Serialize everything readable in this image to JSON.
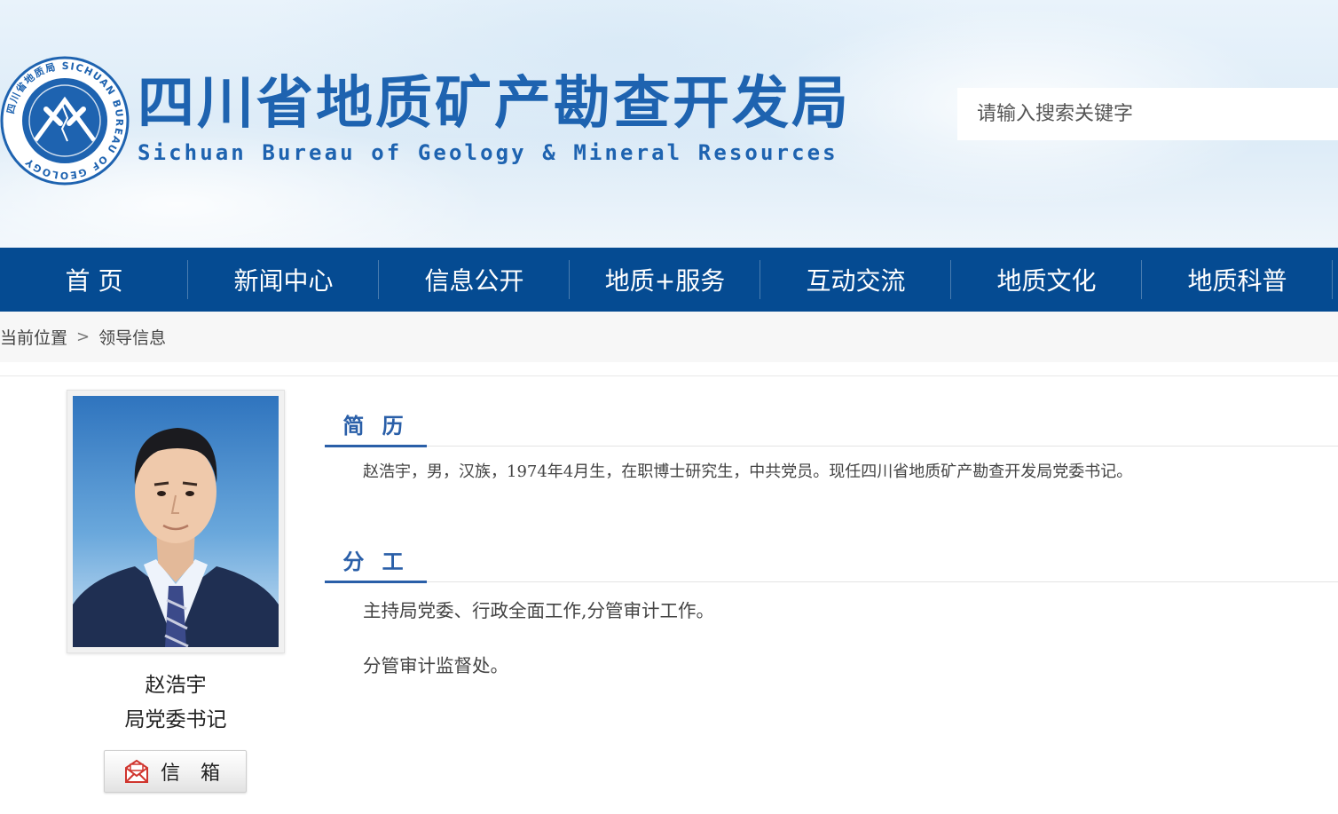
{
  "header": {
    "logo_text": "四川省地质局 SICHUAN BUREAU OF GEOLOGY",
    "title": "四川省地质矿产勘查开发局",
    "subtitle": "Sichuan Bureau of Geology & Mineral Resources",
    "search_placeholder": "请输入搜索关键字",
    "brand_color": "#1e63b0"
  },
  "nav": {
    "background": "#054b92",
    "items": [
      {
        "label": "首 页"
      },
      {
        "label": "新闻中心"
      },
      {
        "label": "信息公开"
      },
      {
        "label": "地质+服务"
      },
      {
        "label": "互动交流"
      },
      {
        "label": "地质文化"
      },
      {
        "label": "地质科普"
      }
    ]
  },
  "breadcrumb": {
    "current_label": "当前位置",
    "separator": ">",
    "page": "领导信息"
  },
  "profile": {
    "name": "赵浩宇",
    "position": "局党委书记",
    "mailbox_label": "信 箱"
  },
  "sections": {
    "resume": {
      "heading": "简 历",
      "text": "赵浩宇，男，汉族，1974年4月生，在职博士研究生，中共党员。现任四川省地质矿产勘查开发局党委书记。"
    },
    "duties": {
      "heading": "分 工",
      "lines": [
        "主持局党委、行政全面工作,分管审计工作。",
        "分管审计监督处。"
      ]
    }
  }
}
